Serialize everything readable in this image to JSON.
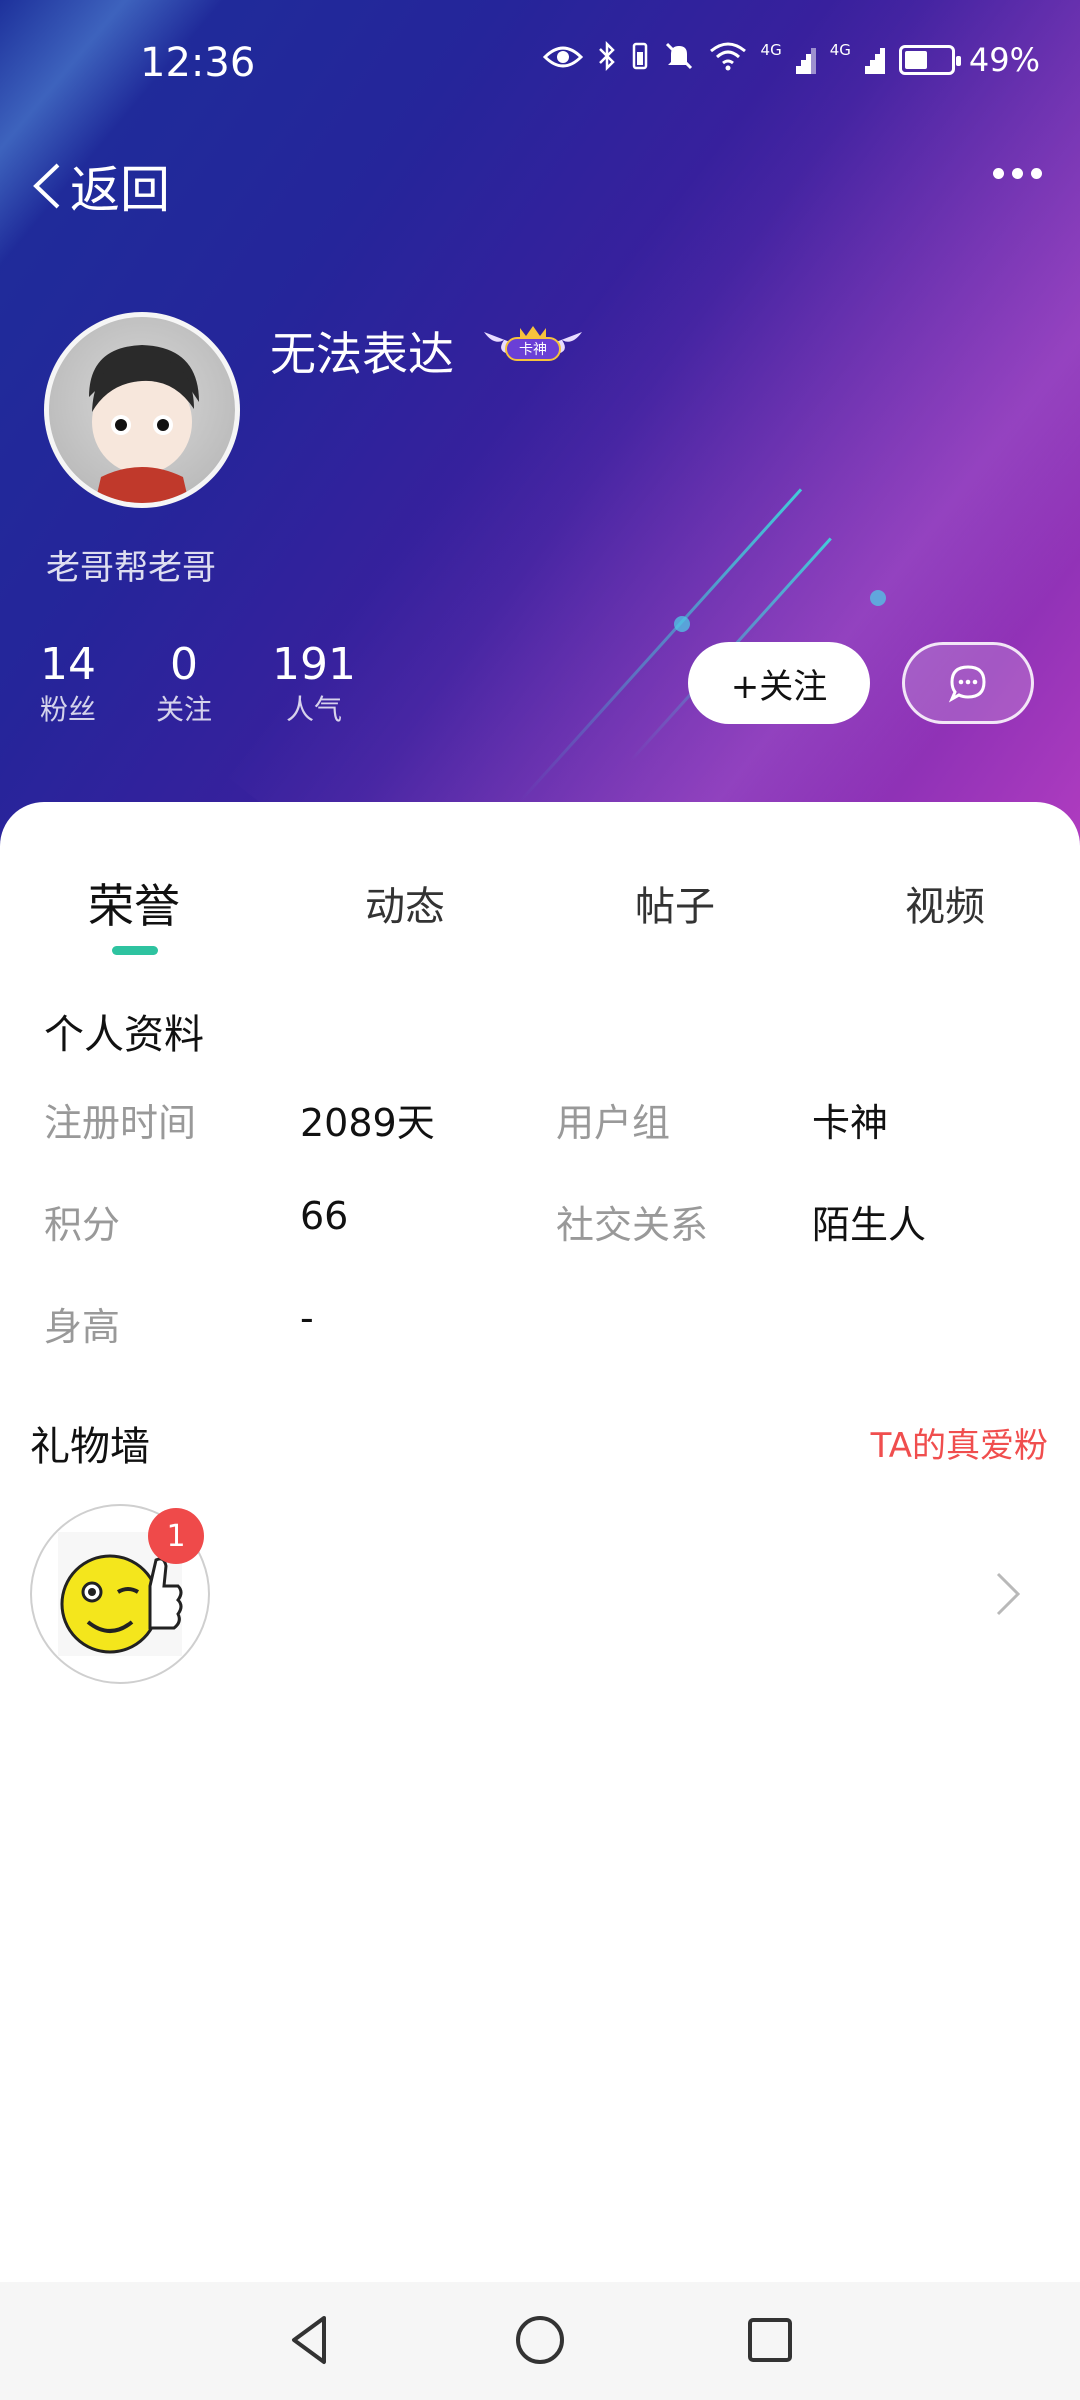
{
  "status_bar": {
    "time": "12:36",
    "network_label_1": "4G",
    "network_label_2": "4G",
    "battery_text": "49%",
    "battery_level": 0.49
  },
  "nav": {
    "back_label": "返回",
    "more_icon": "more-dots-icon"
  },
  "profile": {
    "username": "无法表达",
    "badge_text": "卡神",
    "signature": "老哥帮老哥",
    "stats": [
      {
        "value": "14",
        "label": "粉丝"
      },
      {
        "value": "0",
        "label": "关注"
      },
      {
        "value": "191",
        "label": "人气"
      }
    ],
    "follow_label": "+关注",
    "message_icon": "chat-bubble-icon"
  },
  "tabs": [
    {
      "label": "荣誉",
      "active": true
    },
    {
      "label": "动态",
      "active": false
    },
    {
      "label": "帖子",
      "active": false
    },
    {
      "label": "视频",
      "active": false
    }
  ],
  "personal_info": {
    "title": "个人资料",
    "rows": [
      {
        "k1": "注册时间",
        "v1": "2089天",
        "k2": "用户组",
        "v2": "卡神"
      },
      {
        "k1": "积分",
        "v1": "66",
        "k2": "社交关系",
        "v2": "陌生人"
      },
      {
        "k1": "身高",
        "v1": "-",
        "k2": "",
        "v2": ""
      }
    ]
  },
  "gift_wall": {
    "title": "礼物墙",
    "link": "TA的真爱粉",
    "gift_icon": "thumbs-up-smiley-icon",
    "gift_count": "1"
  },
  "colors": {
    "accent_indicator": "#2ec3a0",
    "link_red": "#f04e4e",
    "badge_red": "#ef4a4a"
  }
}
